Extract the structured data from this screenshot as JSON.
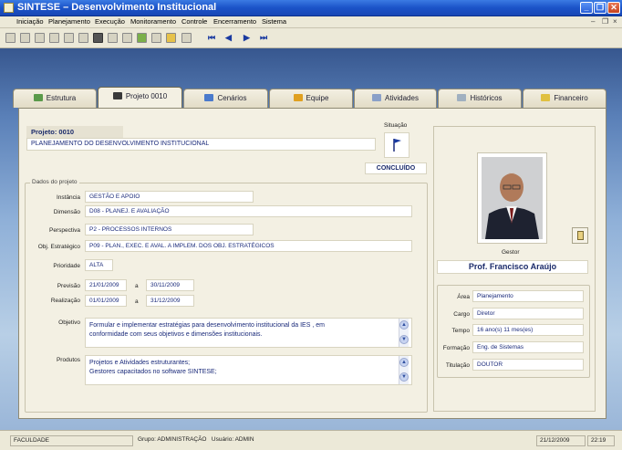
{
  "window": {
    "title": "SINTESE – Desenvolvimento Institucional"
  },
  "menu": [
    "Iniciação",
    "Planejamento",
    "Execução",
    "Monitoramento",
    "Controle",
    "Encerramento",
    "Sistema"
  ],
  "tabs": [
    "Estrutura",
    "Projeto 0010",
    "Cenários",
    "Equipe",
    "Atividades",
    "Históricos",
    "Financeiro"
  ],
  "project": {
    "header": "Projeto: 0010",
    "name": "PLANEJAMENTO DO DESENVOLVIMENTO INSTITUCIONAL",
    "situacao_label": "Situação",
    "status": "CONCLUÍDO"
  },
  "dados": {
    "title": "Dados do projeto",
    "instancia_label": "Instância",
    "instancia": "GESTÃO E APOIO",
    "dimensao_label": "Dimensão",
    "dimensao": "D08 - PLANEJ. E AVALIAÇÃO",
    "perspectiva_label": "Perspectiva",
    "perspectiva": "P2 - PROCESSOS INTERNOS",
    "obj_label": "Obj. Estratégico",
    "obj": "P09 - PLAN., EXEC. E AVAL. A IMPLEM. DOS OBJ. ESTRATÉGICOS",
    "prioridade_label": "Prioridade",
    "prioridade": "ALTA",
    "previsao_label": "Previsão",
    "previsao_ini": "21/01/2009",
    "previsao_fim": "30/11/2009",
    "realizacao_label": "Realização",
    "realizacao_ini": "01/01/2009",
    "realizacao_fim": "31/12/2009",
    "a": "a",
    "objetivo_label": "Objetivo",
    "objetivo_line1": "Formular e implementar estratégias para desenvolvimento institucional da IES , em",
    "objetivo_line2": "conformidade com seus objetivos e dimensões institucionais.",
    "produtos_label": "Produtos",
    "produtos_line1": "Projetos e Atividades estruturantes;",
    "produtos_line2": "Gestores capacitados no software SINTESE;"
  },
  "gestor": {
    "label": "Gestor",
    "name": "Prof. Francisco Araújo",
    "area_label": "Área",
    "area": "Planejamento",
    "cargo_label": "Cargo",
    "cargo": "Diretor",
    "tempo_label": "Tempo",
    "tempo": "16 ano(s) 11 mes(es)",
    "formacao_label": "Formação",
    "formacao": "Eng. de Sistemas",
    "titulacao_label": "Titulação",
    "titulacao": "DOUTOR"
  },
  "status_bar": {
    "org": "FACULDADE",
    "grupo": "Grupo: ADMINISTRAÇÃO",
    "usuario": "Usuário: ADMIN",
    "date": "21/12/2009",
    "time": "22:19"
  }
}
